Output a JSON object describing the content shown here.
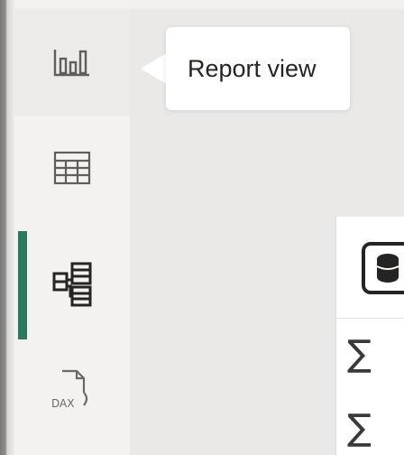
{
  "tooltip": {
    "text": "Report view"
  },
  "nav": {
    "items": [
      {
        "name": "report-view",
        "icon": "bar-chart-icon",
        "selected": true
      },
      {
        "name": "table-view",
        "icon": "table-grid-icon",
        "selected": false
      },
      {
        "name": "model-view",
        "icon": "model-diagram-icon",
        "selected": false,
        "active": true
      },
      {
        "name": "dax-query-view",
        "icon": "dax-document-icon",
        "selected": false
      }
    ],
    "dax_label": "DAX"
  },
  "panel": {
    "header_icon": "database-icon",
    "rows": [
      {
        "icon": "sigma-icon",
        "text": "∑"
      },
      {
        "icon": "sigma-icon",
        "text": "∑"
      }
    ]
  },
  "colors": {
    "accent": "#2b7a60",
    "rail": "#f3f2f1",
    "canvas": "#ebe9e7",
    "tooltip_bg": "#ffffff",
    "text": "#252423"
  }
}
